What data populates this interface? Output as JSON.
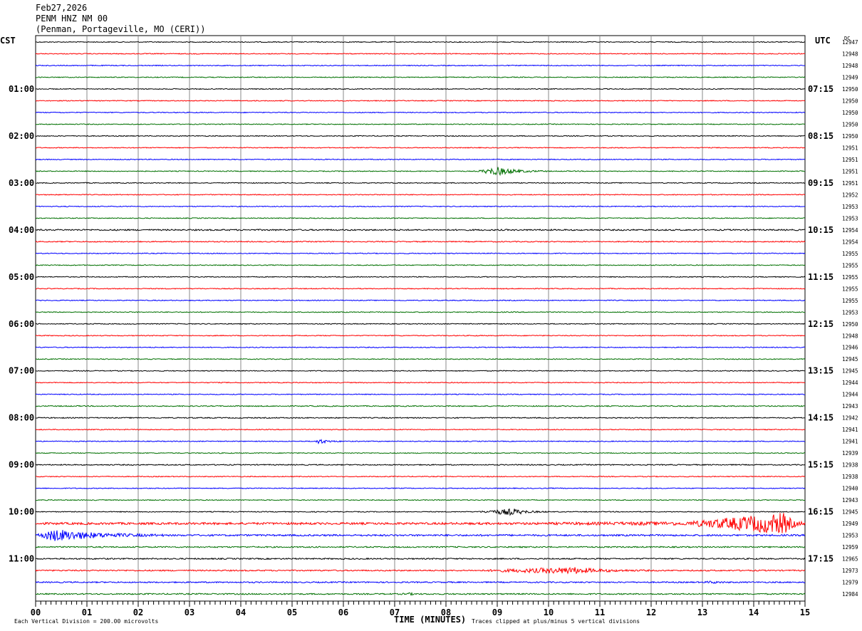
{
  "header": {
    "date": "Feb27,2026",
    "station": "PENM HNZ NM 00",
    "location": "(Penman, Portageville, MO (CERI))"
  },
  "chart_data": {
    "type": "line",
    "title": "PENM HNZ NM 00",
    "left_timezone": "CST",
    "right_timezone": "UTC",
    "dc_label": "DC",
    "xlabel": "TIME (MINUTES)",
    "xlim": [
      0,
      15
    ],
    "x_ticks": [
      "00",
      "01",
      "02",
      "03",
      "04",
      "05",
      "06",
      "07",
      "08",
      "09",
      "10",
      "11",
      "12",
      "13",
      "14",
      "15"
    ],
    "scale_note": "Each Vertical Division =  200.00 microvolts",
    "clip_note": "Traces clipped at plus/minus 5 vertical divisions",
    "trace_colors": [
      "#000000",
      "#ff0000",
      "#0000ff",
      "#007000"
    ],
    "left_hour_labels": [
      {
        "row": 4,
        "label": "01:00"
      },
      {
        "row": 8,
        "label": "02:00"
      },
      {
        "row": 12,
        "label": "03:00"
      },
      {
        "row": 16,
        "label": "04:00"
      },
      {
        "row": 20,
        "label": "05:00"
      },
      {
        "row": 24,
        "label": "06:00"
      },
      {
        "row": 28,
        "label": "07:00"
      },
      {
        "row": 32,
        "label": "08:00"
      },
      {
        "row": 36,
        "label": "09:00"
      },
      {
        "row": 40,
        "label": "10:00"
      },
      {
        "row": 44,
        "label": "11:00"
      }
    ],
    "right_hour_labels": [
      {
        "row": 4,
        "label": "07:15"
      },
      {
        "row": 8,
        "label": "08:15"
      },
      {
        "row": 12,
        "label": "09:15"
      },
      {
        "row": 16,
        "label": "10:15"
      },
      {
        "row": 20,
        "label": "11:15"
      },
      {
        "row": 24,
        "label": "12:15"
      },
      {
        "row": 28,
        "label": "13:15"
      },
      {
        "row": 32,
        "label": "14:15"
      },
      {
        "row": 36,
        "label": "15:15"
      },
      {
        "row": 40,
        "label": "16:15"
      },
      {
        "row": 44,
        "label": "17:15"
      }
    ],
    "dc_values": [
      "12947",
      "12948",
      "12948",
      "12949",
      "12950",
      "12950",
      "12950",
      "12950",
      "12950",
      "12951",
      "12951",
      "12951",
      "12951",
      "12952",
      "12953",
      "12953",
      "12954",
      "12954",
      "12955",
      "12955",
      "12955",
      "12955",
      "12955",
      "12953",
      "12950",
      "12948",
      "12946",
      "12945",
      "12945",
      "12944",
      "12944",
      "12943",
      "12942",
      "12941",
      "12941",
      "12939",
      "12938",
      "12938",
      "12940",
      "12943",
      "12945",
      "12949",
      "12953",
      "12959",
      "12965",
      "12973",
      "12979",
      "12984"
    ],
    "noise_level": [
      1,
      1,
      1,
      1,
      1,
      1,
      1,
      1,
      1,
      1,
      1,
      1,
      1,
      1,
      1,
      1,
      1.6,
      1.2,
      1,
      1,
      1,
      1,
      1,
      1,
      1,
      1,
      1,
      1,
      1,
      1,
      1,
      1.2,
      1.2,
      1,
      1,
      1,
      1.2,
      1,
      1,
      1,
      1,
      2.5,
      2,
      1.5,
      1.5,
      1.5,
      1.5,
      1.5
    ],
    "events": [
      {
        "row": 11,
        "start_min": 8.6,
        "end_min": 10.0,
        "peak_min": 9.0,
        "amplitude_div": 1.4
      },
      {
        "row": 34,
        "start_min": 5.45,
        "end_min": 6.0,
        "peak_min": 5.5,
        "amplitude_div": 0.9
      },
      {
        "row": 40,
        "start_min": 8.6,
        "end_min": 10.0,
        "peak_min": 9.3,
        "amplitude_div": 1.1
      },
      {
        "row": 41,
        "start_min": 12.5,
        "end_min": 15.0,
        "peak_min": 14.6,
        "amplitude_div": 3.5
      },
      {
        "row": 41,
        "start_min": 9.5,
        "end_min": 12.5,
        "peak_min": 12.5,
        "amplitude_div": 0.3
      },
      {
        "row": 42,
        "start_min": 0.0,
        "end_min": 2.5,
        "peak_min": 0.4,
        "amplitude_div": 2.0
      },
      {
        "row": 45,
        "start_min": 8.6,
        "end_min": 12.0,
        "peak_min": 10.5,
        "amplitude_div": 1.0
      },
      {
        "row": 47,
        "start_min": 7.1,
        "end_min": 7.5,
        "peak_min": 7.3,
        "amplitude_div": 0.25
      },
      {
        "row": 46,
        "start_min": 13.0,
        "end_min": 13.6,
        "peak_min": 13.2,
        "amplitude_div": 0.3
      }
    ]
  }
}
